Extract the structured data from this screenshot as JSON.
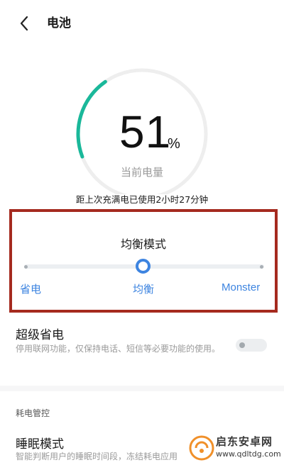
{
  "header": {
    "title": "电池",
    "back_icon": "chevron-left-icon"
  },
  "battery": {
    "percent": "51",
    "percent_unit": "%",
    "caption": "当前电量",
    "level_fraction": 0.51,
    "gauge_color": "#1ab89a",
    "usage_text": "距上次充满电已使用2小时27分钟"
  },
  "power_mode": {
    "title": "均衡模式",
    "options": [
      "省电",
      "均衡",
      "Monster"
    ],
    "selected": "均衡",
    "accent_color": "#3d84e0"
  },
  "super_saver": {
    "title": "超级省电",
    "description": "停用联网功能，仅保持电话、短信等必要功能的使用。",
    "enabled": false
  },
  "consumption": {
    "section_title": "耗电管控",
    "sleep_mode": {
      "title": "睡眠模式",
      "description": "智能判断用户的睡眠时间段，冻结耗电应用"
    }
  },
  "watermark": {
    "text": "启东安卓网",
    "url": "www.qdltdg.com"
  }
}
